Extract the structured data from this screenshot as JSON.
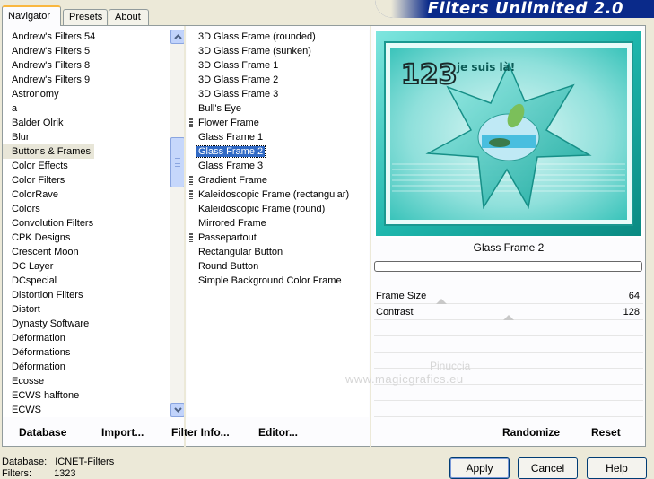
{
  "tabs": [
    {
      "label": "Navigator"
    },
    {
      "label": "Presets"
    },
    {
      "label": "About"
    }
  ],
  "banner": {
    "title": "Filters Unlimited 2.0"
  },
  "categories": {
    "items": [
      "Andrew's Filters 54",
      "Andrew's Filters 5",
      "Andrew's Filters 8",
      "Andrew's Filters 9",
      "Astronomy",
      "a",
      "Balder Olrik",
      "Blur",
      "Buttons & Frames",
      "Color Effects",
      "Color Filters",
      "ColorRave",
      "Colors",
      "Convolution Filters",
      "CPK Designs",
      "Crescent Moon",
      "DC Layer",
      "DCspecial",
      "Distortion Filters",
      "Distort",
      "Dynasty Software",
      "Déformation",
      "Déformations",
      "Déformation",
      "Ecosse",
      "ECWS halftone",
      "ECWS"
    ],
    "selected": "Buttons & Frames"
  },
  "filters": {
    "items": [
      {
        "label": "3D Glass Frame (rounded)",
        "grip": false
      },
      {
        "label": "3D Glass Frame (sunken)",
        "grip": false
      },
      {
        "label": "3D Glass Frame 1",
        "grip": false
      },
      {
        "label": "3D Glass Frame 2",
        "grip": false
      },
      {
        "label": "3D Glass Frame 3",
        "grip": false
      },
      {
        "label": "Bull's Eye",
        "grip": false
      },
      {
        "label": "Flower Frame",
        "grip": true
      },
      {
        "label": "Glass Frame 1",
        "grip": false
      },
      {
        "label": "Glass Frame 2",
        "grip": false
      },
      {
        "label": "Glass Frame 3",
        "grip": false
      },
      {
        "label": "Gradient Frame",
        "grip": true
      },
      {
        "label": "Kaleidoscopic Frame (rectangular)",
        "grip": true
      },
      {
        "label": "Kaleidoscopic Frame (round)",
        "grip": false
      },
      {
        "label": "Mirrored Frame",
        "grip": false
      },
      {
        "label": "Passepartout",
        "grip": true
      },
      {
        "label": "Rectangular Button",
        "grip": false
      },
      {
        "label": "Round Button",
        "grip": false
      },
      {
        "label": "Simple Background Color Frame",
        "grip": false
      }
    ],
    "selected": "Glass Frame 2"
  },
  "preview": {
    "filter_name": "Glass Frame 2",
    "image_text_big": "123",
    "image_text_small": "je suis là!",
    "progress": 0
  },
  "params": [
    {
      "label": "Frame Size",
      "value": "64",
      "slider_fraction": 0.25
    },
    {
      "label": "Contrast",
      "value": "128",
      "slider_fraction": 0.5
    }
  ],
  "watermark": {
    "line1": "Pinuccia",
    "line2": "www.magicgrafics.eu"
  },
  "toolbar": {
    "database": "Database",
    "import": "Import...",
    "filter_info": "Filter Info...",
    "editor": "Editor...",
    "randomize": "Randomize",
    "reset": "Reset"
  },
  "status": {
    "database_label": "Database:",
    "database_value": "ICNET-Filters",
    "filters_label": "Filters:",
    "filters_value": "1323"
  },
  "buttons": {
    "apply": "Apply",
    "cancel": "Cancel",
    "help": "Help"
  },
  "colors": {
    "selection": "#316ac5",
    "banner": "#0a2a8a",
    "preview_teal": "#1fb7ad"
  }
}
